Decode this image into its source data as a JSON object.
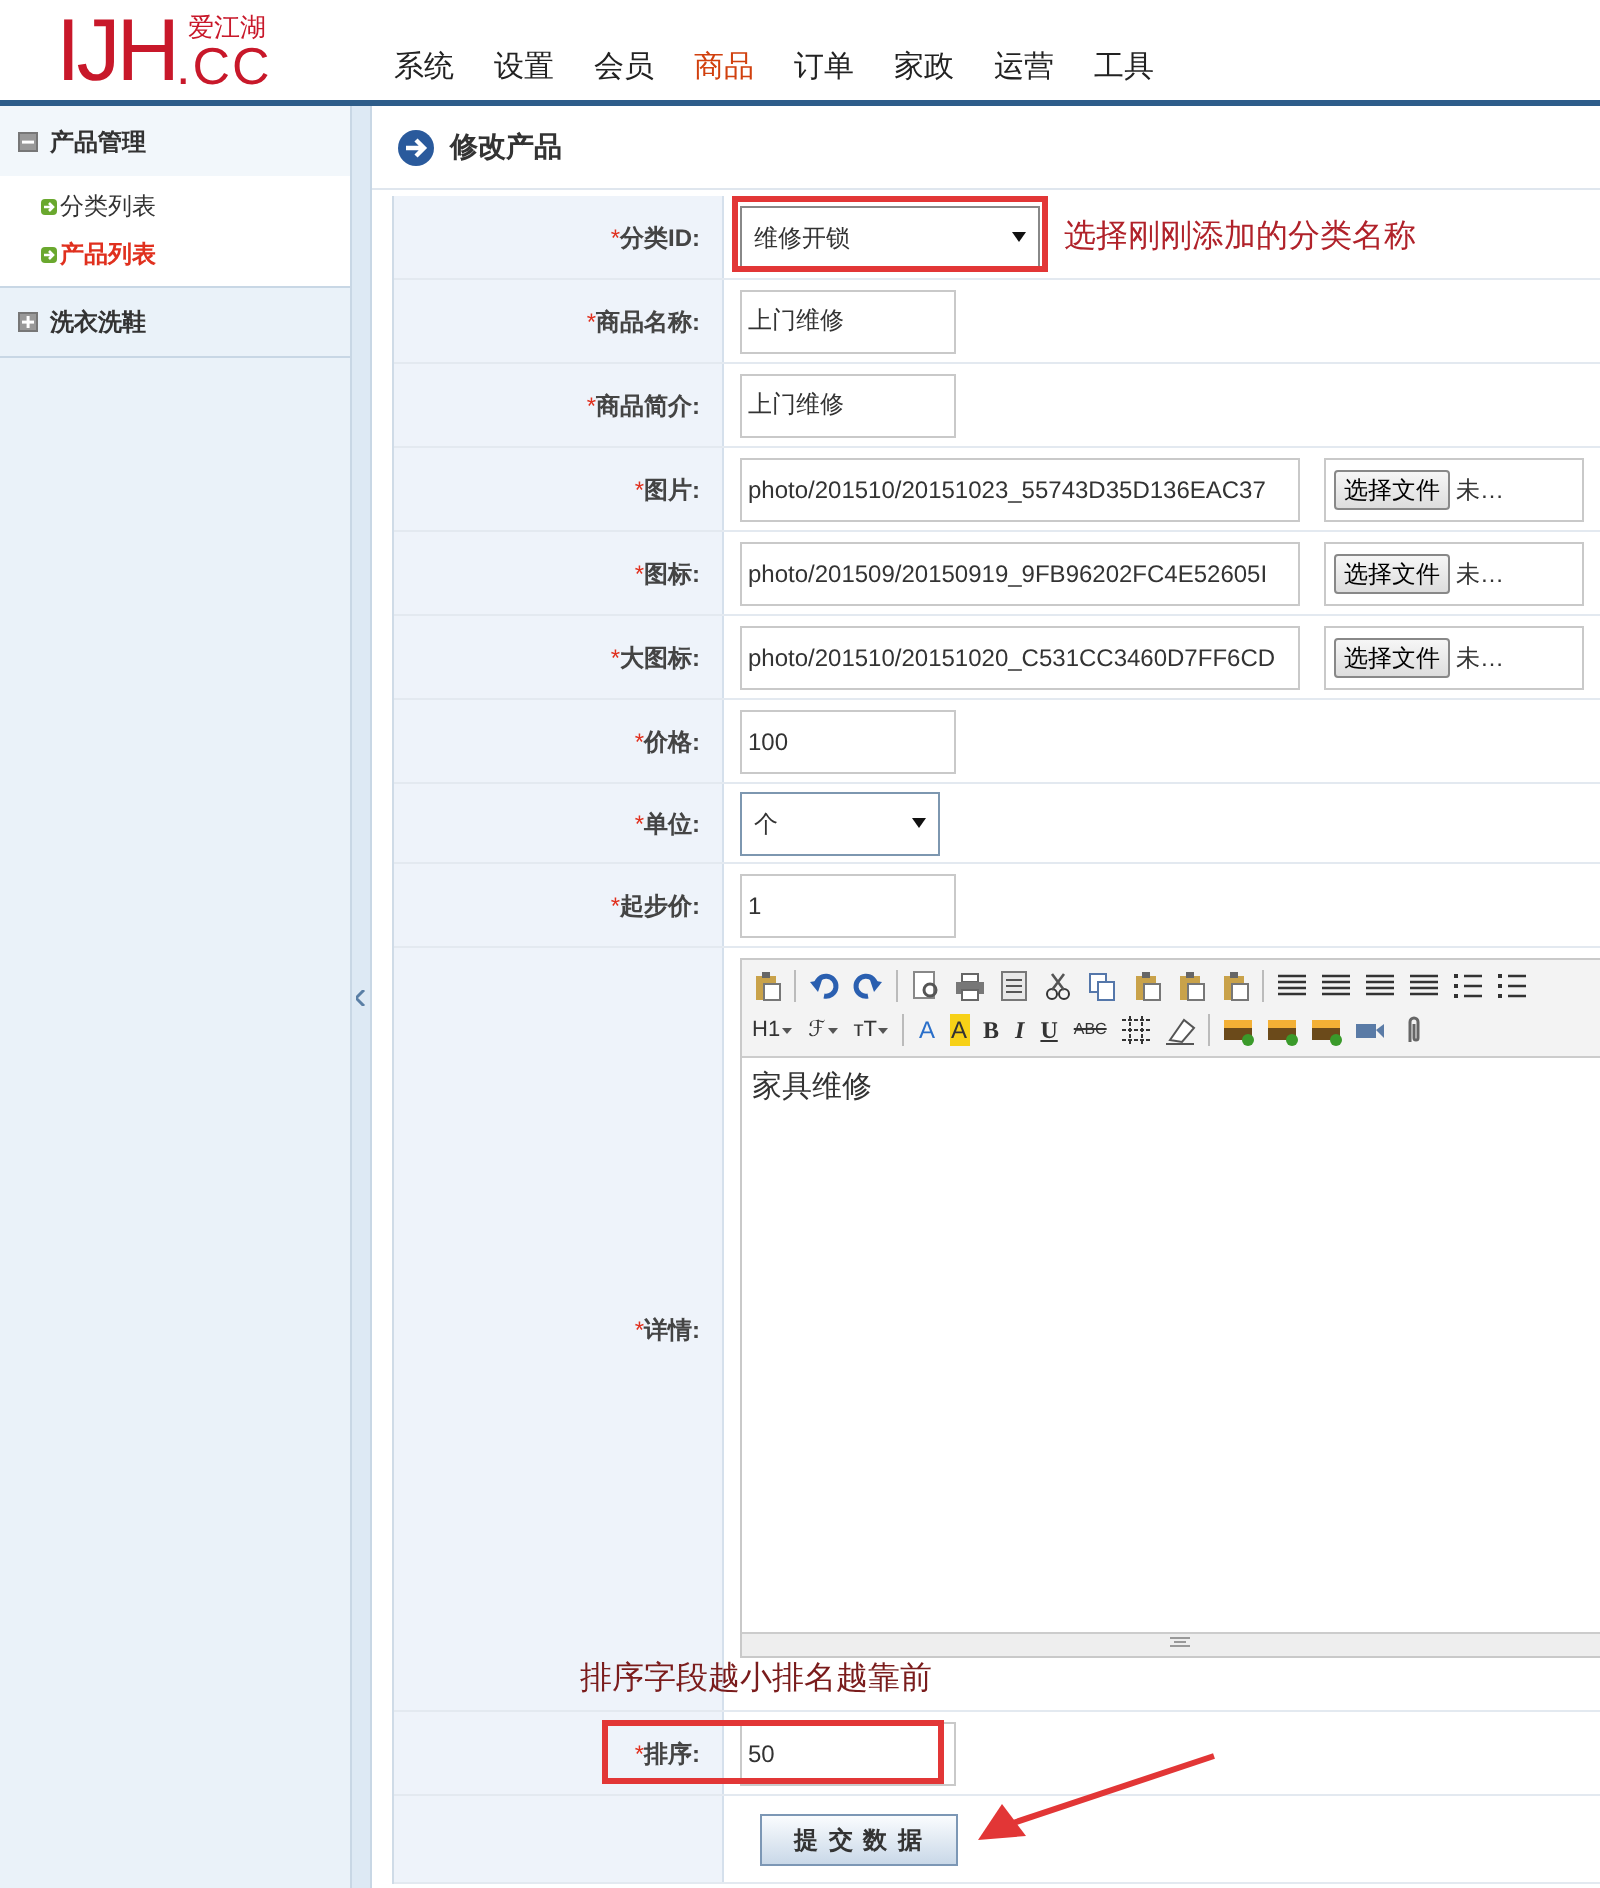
{
  "logo": {
    "mark": "IJH",
    "domain": ".CC",
    "brand": "爱江湖"
  },
  "nav": [
    {
      "label": "系统",
      "selected": false
    },
    {
      "label": "设置",
      "selected": false
    },
    {
      "label": "会员",
      "selected": false
    },
    {
      "label": "商品",
      "selected": true
    },
    {
      "label": "订单",
      "selected": false
    },
    {
      "label": "家政",
      "selected": false
    },
    {
      "label": "运营",
      "selected": false
    },
    {
      "label": "工具",
      "selected": false
    }
  ],
  "sidebar": {
    "groups": [
      {
        "title": "产品管理",
        "expanded": true,
        "items": [
          {
            "label": "分类列表",
            "selected": false
          },
          {
            "label": "产品列表",
            "selected": true
          }
        ]
      },
      {
        "title": "洗衣洗鞋",
        "expanded": false
      }
    ]
  },
  "page_title": "修改产品",
  "form": {
    "rows": [
      {
        "label": "分类ID:",
        "marker": "*",
        "kind": "select",
        "value": "维修开锁",
        "callout": true,
        "note": "选择刚刚添加的分类名称"
      },
      {
        "label": "商品名称:",
        "marker": "*",
        "kind": "text",
        "value": "上门维修"
      },
      {
        "label": "商品简介:",
        "marker": "*",
        "kind": "text",
        "value": "上门维修"
      },
      {
        "label": "图片:",
        "marker": "*",
        "kind": "file",
        "value": "photo/201510/20151023_55743D35D136EAC37",
        "button": "选择文件",
        "status": "未…"
      },
      {
        "label": "图标:",
        "marker": "*",
        "kind": "file",
        "value": "photo/201509/20150919_9FB96202FC4E52605I",
        "button": "选择文件",
        "status": "未…"
      },
      {
        "label": "大图标:",
        "marker": "*",
        "kind": "file",
        "value": "photo/201510/20151020_C531CC3460D7FF6CD",
        "button": "选择文件",
        "status": "未…"
      },
      {
        "label": "价格:",
        "marker": "*",
        "kind": "text",
        "value": "100"
      },
      {
        "label": "单位:",
        "marker": "*",
        "kind": "select-small",
        "value": "个"
      },
      {
        "label": "起步价:",
        "marker": "*",
        "kind": "text",
        "value": "1"
      },
      {
        "label": "详情:",
        "marker": "*",
        "kind": "editor",
        "value": "家具维修",
        "format_buttons": [
          {
            "label": "H1",
            "kind": "dropdown"
          },
          {
            "label": "ℱ",
            "kind": "dropdown"
          },
          {
            "label": "тT",
            "kind": "dropdown"
          },
          {
            "label": "A",
            "kind": "color"
          },
          {
            "label": "A",
            "kind": "highlight"
          },
          {
            "label": "B",
            "kind": "bold"
          },
          {
            "label": "I",
            "kind": "italic"
          },
          {
            "label": "U",
            "kind": "underline"
          },
          {
            "label": "ABC",
            "kind": "strike"
          }
        ]
      },
      {
        "label": "排序:",
        "marker": "*",
        "kind": "text",
        "value": "50",
        "callout": true,
        "note_above": "排序字段越小排名越靠前"
      }
    ]
  },
  "submit": "提 交 数 据"
}
